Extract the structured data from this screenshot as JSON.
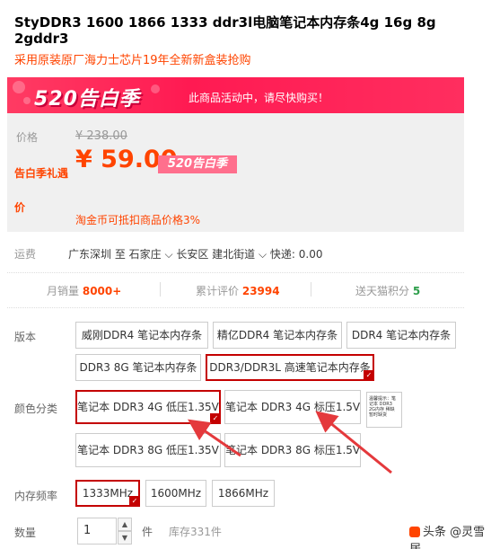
{
  "product": {
    "title": "StyDDR3 1600 1866 1333 ddr3l电脑笔记本内存条4g 16g 8g 2gddr3",
    "subtitle": "采用原装原厂海力士芯片19年全新新盒装抢购"
  },
  "promo": {
    "logo": "520告白季",
    "text": "此商品活动中，请尽快购买！",
    "bg_color": "#ff2e5f"
  },
  "price": {
    "original_label": "价格",
    "original_value": "¥ 238.00",
    "sale_label": "告白季礼遇价",
    "sale_value": "¥ 59.00",
    "badge": "520告白季",
    "coin_note": "淘金币可抵扣商品价格3%"
  },
  "shipping": {
    "label": "运费",
    "text": "广东深圳  至  石家庄 ⌵ 长安区  建北街道 ⌵  快递: 0.00"
  },
  "stats": {
    "monthly_sales_label": "月销量",
    "monthly_sales_value": "8000+",
    "reviews_label": "累计评价",
    "reviews_value": "23994",
    "points_label": "送天猫积分",
    "points_value": "5"
  },
  "options": {
    "version_label": "版本",
    "version": [
      "威刚DDR4 笔记本内存条",
      "精亿DDR4 笔记本内存条",
      "DDR4 笔记本内存条",
      "DDR3 8G 笔记本内存条",
      "DDR3/DDR3L 高速笔记本内存条"
    ],
    "color_label": "颜色分类",
    "color": [
      "笔记本 DDR3 4G 低压1.35V",
      "笔记本 DDR3 4G 标压1.5V",
      "笔记本 DDR3 8G 低压1.35V",
      "笔记本 DDR3 8G 标压1.5V"
    ],
    "thumb_text": "温馨提示：笔记本 DDR3 2G内存 稀缺 暂时缺货",
    "freq_label": "内存频率",
    "freq": [
      "1333MHz",
      "1600MHz",
      "1866MHz"
    ]
  },
  "quantity": {
    "label": "数量",
    "value": "1",
    "up": "▲",
    "down": "▼",
    "unit": "件",
    "stock": "库存331件"
  },
  "watermark": "头条 @灵雪居"
}
